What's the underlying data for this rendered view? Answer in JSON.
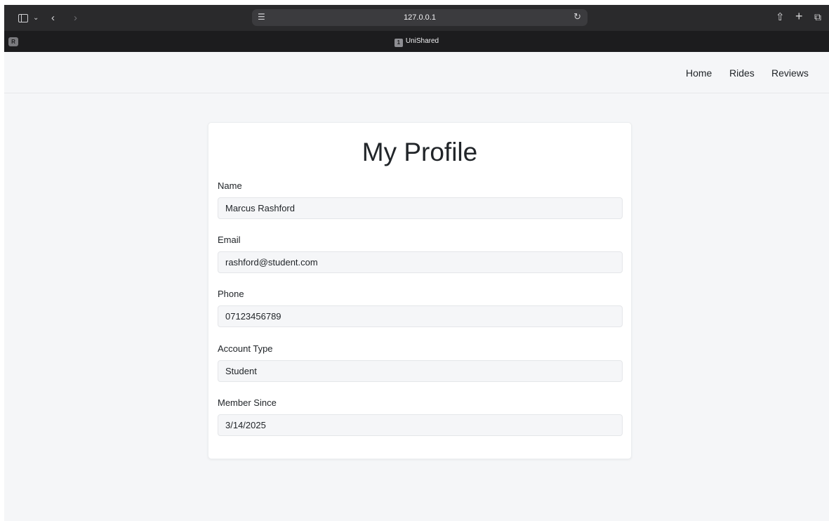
{
  "browser": {
    "url": "127.0.0.1",
    "profile_badge": "R",
    "tab": {
      "number": "1",
      "title": "UniShared"
    },
    "icons": {
      "sidebar": "sidebar-toggle-icon",
      "dropdown": "chevron-down-icon",
      "back": "back-arrow-icon",
      "forward": "forward-arrow-icon",
      "site": "site-settings-icon",
      "reload": "reload-icon",
      "share": "share-icon",
      "new_tab": "plus-icon",
      "tab_overview": "tab-overview-icon"
    }
  },
  "nav": {
    "home": "Home",
    "rides": "Rides",
    "reviews": "Reviews"
  },
  "profile": {
    "title": "My Profile",
    "fields": [
      {
        "label": "Name",
        "value": "Marcus Rashford"
      },
      {
        "label": "Email",
        "value": "rashford@student.com"
      },
      {
        "label": "Phone",
        "value": "07123456789"
      },
      {
        "label": "Account Type",
        "value": "Student"
      },
      {
        "label": "Member Since",
        "value": "3/14/2025"
      }
    ]
  }
}
